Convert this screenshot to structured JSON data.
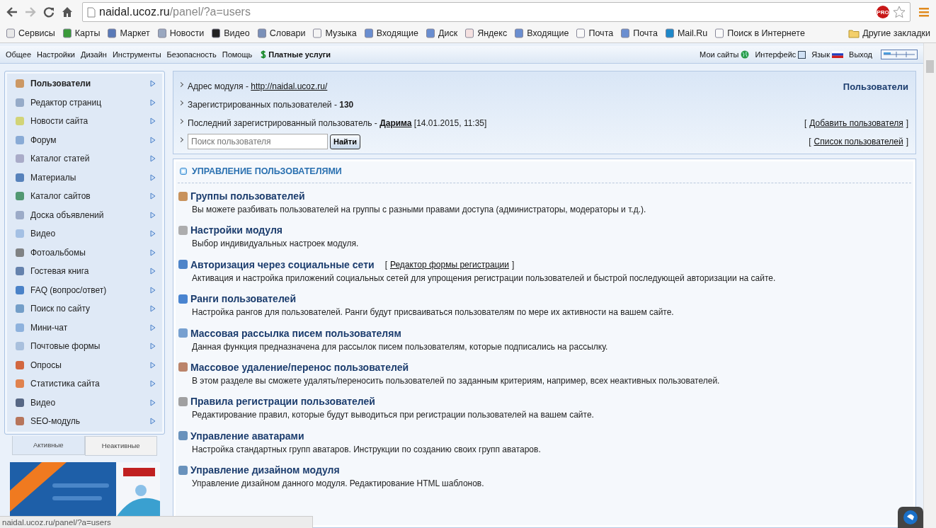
{
  "browser": {
    "url_host": "naidal.ucoz.ru",
    "url_path": "/panel/?a=users",
    "badge": "PRO"
  },
  "bookmarks": [
    {
      "label": "Сервисы"
    },
    {
      "label": "Карты"
    },
    {
      "label": "Маркет"
    },
    {
      "label": "Новости"
    },
    {
      "label": "Видео"
    },
    {
      "label": "Словари"
    },
    {
      "label": "Музыка"
    },
    {
      "label": "Входящие"
    },
    {
      "label": "Диск"
    },
    {
      "label": "Яндекс"
    },
    {
      "label": "Входящие"
    },
    {
      "label": "Почта"
    },
    {
      "label": "Почта"
    },
    {
      "label": "Mail.Ru"
    },
    {
      "label": "Поиск в Интернете"
    }
  ],
  "other_bookmarks": "Другие закладки",
  "top_menu": [
    "Общее",
    "Настройки",
    "Дизайн",
    "Инструменты",
    "Безопасность",
    "Помощь"
  ],
  "paid_services": "Платные услуги",
  "top_right": [
    "Мои сайты",
    "Интерфейс",
    "Язык",
    "Выход"
  ],
  "sidebar": {
    "items": [
      {
        "label": "Пользователи",
        "selected": true
      },
      {
        "label": "Редактор страниц",
        "selected": false
      },
      {
        "label": "Новости сайта",
        "selected": false
      },
      {
        "label": "Форум",
        "selected": false
      },
      {
        "label": "Каталог статей",
        "selected": false
      },
      {
        "label": "Материалы",
        "selected": false
      },
      {
        "label": "Каталог сайтов",
        "selected": false
      },
      {
        "label": "Доска объявлений",
        "selected": false
      },
      {
        "label": "Видео",
        "selected": false
      },
      {
        "label": "Фотоальбомы",
        "selected": false
      },
      {
        "label": "Гостевая книга",
        "selected": false
      },
      {
        "label": "FAQ (вопрос/ответ)",
        "selected": false
      },
      {
        "label": "Поиск по сайту",
        "selected": false
      },
      {
        "label": "Мини-чат",
        "selected": false
      },
      {
        "label": "Почтовые формы",
        "selected": false
      },
      {
        "label": "Опросы",
        "selected": false
      },
      {
        "label": "Статистика сайта",
        "selected": false
      },
      {
        "label": "Видео",
        "selected": false
      },
      {
        "label": "SEO-модуль",
        "selected": false
      }
    ],
    "tabs": [
      {
        "label": "Активные",
        "selected": true
      },
      {
        "label": "Неактивные",
        "selected": false
      }
    ]
  },
  "info": {
    "title": "Пользователи",
    "address_label": "Адрес модуля - ",
    "address_link": "http://naidal.ucoz.ru/",
    "registered": "Зарегистрированных пользователей - **130**",
    "last_label": "Последний зарегистрированный пользователь - ",
    "last_user": "Дарима",
    "last_date": " [14.01.2015, 11:35]",
    "search_placeholder": "Поиск пользователя",
    "search_button": "Найти",
    "links": [
      {
        "open": "[",
        "text": "Добавить пользователя",
        "close": "]"
      },
      {
        "open": "[",
        "text": "Список пользователей",
        "close": "]"
      }
    ]
  },
  "management": {
    "heading": "УПРАВЛЕНИЕ ПОЛЬЗОВАТЕЛЯМИ",
    "items": [
      {
        "title": "Группы пользователей",
        "description": "Вы можете разбивать пользователей на группы с разными правами доступа (администраторы, модераторы и т.д.)."
      },
      {
        "title": "Настройки модуля",
        "description": "Выбор индивидуальных настроек модуля."
      },
      {
        "title": "Авторизация через социальные сети",
        "link": {
          "open": "[",
          "text": "Редактор формы регистрации",
          "close": "]"
        },
        "description": "Активация и настройка приложений социальных сетей для упрощения регистрации пользователей и быстрой последующей авторизации на сайте."
      },
      {
        "title": "Ранги пользователей",
        "description": "Настройка рангов для пользователей. Ранги будут присваиваться пользователям по мере их активности на вашем сайте."
      },
      {
        "title": "Массовая рассылка писем пользователям",
        "description": "Данная функция предназначена для рассылок писем пользователям, которые подписались на рассылку."
      },
      {
        "title": "Массовое удаление/перенос пользователей",
        "description": "В этом разделе вы сможете удалять/переносить пользователей по заданным критериям, например, всех неактивных пользователей."
      },
      {
        "title": "Правила регистрации пользователей",
        "description": "Редактирование правил, которые будут выводиться при регистрации пользователей на вашем сайте."
      },
      {
        "title": "Управление аватарами",
        "description": "Настройка стандартных групп аватаров. Инструкции по созданию своих групп аватаров."
      },
      {
        "title": "Управление дизайном модуля",
        "description": "Управление дизайном данного модуля. Редактирование HTML шаблонов."
      }
    ]
  },
  "status_bar": "naidal.ucoz.ru/panel/?a=users"
}
